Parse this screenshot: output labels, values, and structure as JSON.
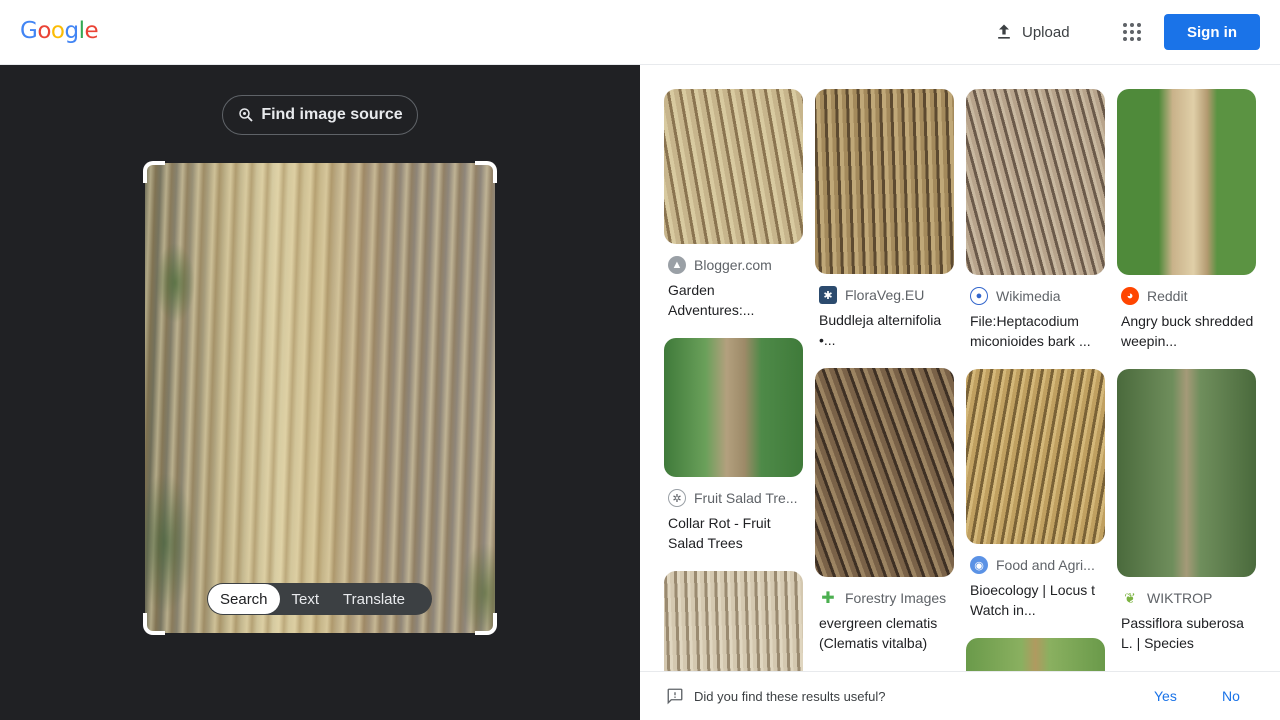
{
  "header": {
    "logo_letters": [
      "G",
      "o",
      "o",
      "g",
      "l",
      "e"
    ],
    "upload_label": "Upload",
    "signin_label": "Sign in"
  },
  "lens": {
    "find_source_label": "Find image source",
    "tabs": [
      {
        "label": "Search",
        "active": true
      },
      {
        "label": "Text",
        "active": false
      },
      {
        "label": "Translate",
        "active": false
      }
    ]
  },
  "results": {
    "columns": [
      [
        {
          "source": "Blogger.com",
          "title": "Garden Adventures:...",
          "icon": "blogger-icon",
          "color": "#9aa0a6"
        },
        {
          "source": "Fruit Salad Tre...",
          "title": "Collar Rot - Fruit Salad Trees",
          "icon": "fruit-salad-icon",
          "color": "#5f6368"
        },
        {
          "source": "",
          "title": "",
          "icon": "",
          "color": ""
        }
      ],
      [
        {
          "source": "FloraVeg.EU",
          "title": "Buddleja alternifolia •...",
          "icon": "floraveg-icon",
          "color": "#2c4b6e"
        },
        {
          "source": "Forestry Images",
          "title": "evergreen clematis (Clematis vitalba)",
          "icon": "forestry-icon",
          "color": "#4caf50"
        }
      ],
      [
        {
          "source": "Wikimedia",
          "title": "File:Heptacodium miconioides bark ...",
          "icon": "wikimedia-icon",
          "color": "#3366cc"
        },
        {
          "source": "Food and Agri...",
          "title": "Bioecology | Locus t Watch in...",
          "icon": "fao-icon",
          "color": "#5b92e5"
        }
      ],
      [
        {
          "source": "Reddit",
          "title": "Angry buck shredded weepin...",
          "icon": "reddit-icon",
          "color": "#ff4500"
        },
        {
          "source": "WIKTROP",
          "title": "Passiflora suberosa L. | Species",
          "icon": "wiktrop-icon",
          "color": "#7cb342"
        }
      ]
    ]
  },
  "feedback": {
    "question": "Did you find these results useful?",
    "yes_label": "Yes",
    "no_label": "No"
  }
}
